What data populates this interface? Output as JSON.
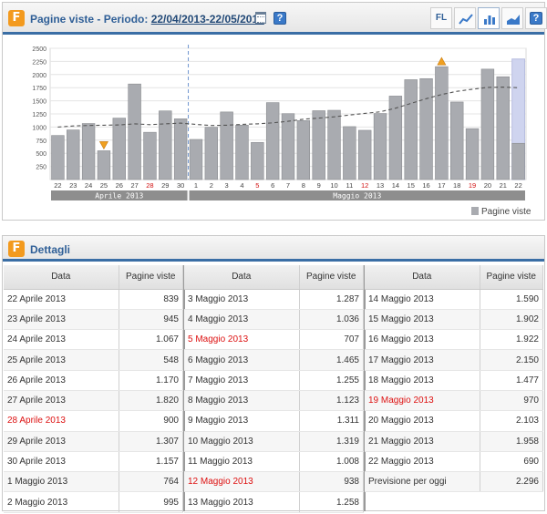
{
  "header": {
    "logo_letter": "F",
    "title_prefix": "Pagine viste - Periodo: ",
    "period": "22/04/2013-22/05/2013",
    "tools": {
      "fl_label": "FL",
      "help_label": "?"
    }
  },
  "legend": {
    "label": "Pagine viste"
  },
  "details": {
    "logo_letter": "F",
    "title": "Dettagli",
    "col_date": "Data",
    "col_value": "Pagine viste",
    "columns": [
      [
        {
          "date": "22 Aprile 2013",
          "value": "839",
          "red": false
        },
        {
          "date": "23 Aprile 2013",
          "value": "945",
          "red": false
        },
        {
          "date": "24 Aprile 2013",
          "value": "1.067",
          "red": false
        },
        {
          "date": "25 Aprile 2013",
          "value": "548",
          "red": false
        },
        {
          "date": "26 Aprile 2013",
          "value": "1.170",
          "red": false
        },
        {
          "date": "27 Aprile 2013",
          "value": "1.820",
          "red": false
        },
        {
          "date": "28 Aprile 2013",
          "value": "900",
          "red": true
        },
        {
          "date": "29 Aprile 2013",
          "value": "1.307",
          "red": false
        },
        {
          "date": "30 Aprile 2013",
          "value": "1.157",
          "red": false
        },
        {
          "date": "1 Maggio 2013",
          "value": "764",
          "red": false
        },
        {
          "date": "2 Maggio 2013",
          "value": "995",
          "red": false
        }
      ],
      [
        {
          "date": "3 Maggio 2013",
          "value": "1.287",
          "red": false
        },
        {
          "date": "4 Maggio 2013",
          "value": "1.036",
          "red": false
        },
        {
          "date": "5 Maggio 2013",
          "value": "707",
          "red": true
        },
        {
          "date": "6 Maggio 2013",
          "value": "1.465",
          "red": false
        },
        {
          "date": "7 Maggio 2013",
          "value": "1.255",
          "red": false
        },
        {
          "date": "8 Maggio 2013",
          "value": "1.123",
          "red": false
        },
        {
          "date": "9 Maggio 2013",
          "value": "1.311",
          "red": false
        },
        {
          "date": "10 Maggio 2013",
          "value": "1.319",
          "red": false
        },
        {
          "date": "11 Maggio 2013",
          "value": "1.008",
          "red": false
        },
        {
          "date": "12 Maggio 2013",
          "value": "938",
          "red": true
        },
        {
          "date": "13 Maggio 2013",
          "value": "1.258",
          "red": false
        }
      ],
      [
        {
          "date": "14 Maggio 2013",
          "value": "1.590",
          "red": false
        },
        {
          "date": "15 Maggio 2013",
          "value": "1.902",
          "red": false
        },
        {
          "date": "16 Maggio 2013",
          "value": "1.922",
          "red": false
        },
        {
          "date": "17 Maggio 2013",
          "value": "2.150",
          "red": false
        },
        {
          "date": "18 Maggio 2013",
          "value": "1.477",
          "red": false
        },
        {
          "date": "19 Maggio 2013",
          "value": "970",
          "red": true
        },
        {
          "date": "20 Maggio 2013",
          "value": "2.103",
          "red": false
        },
        {
          "date": "21 Maggio 2013",
          "value": "1.958",
          "red": false
        },
        {
          "date": "22 Maggio 2013",
          "value": "690",
          "red": false
        },
        {
          "date": "Previsione per oggi",
          "value": "2.296",
          "red": false
        }
      ]
    ]
  },
  "chart_data": {
    "type": "bar",
    "categories": [
      "22",
      "23",
      "24",
      "25",
      "26",
      "27",
      "28",
      "29",
      "30",
      "1",
      "2",
      "3",
      "4",
      "5",
      "6",
      "7",
      "8",
      "9",
      "10",
      "11",
      "12",
      "13",
      "14",
      "15",
      "16",
      "17",
      "18",
      "19",
      "20",
      "21",
      "22"
    ],
    "red_categories": [
      6,
      13,
      20,
      27
    ],
    "series": [
      {
        "name": "Pagine viste",
        "values": [
          839,
          945,
          1067,
          548,
          1170,
          1820,
          900,
          1307,
          1157,
          764,
          995,
          1287,
          1036,
          707,
          1465,
          1255,
          1123,
          1311,
          1319,
          1008,
          938,
          1258,
          1590,
          1902,
          1922,
          2150,
          1477,
          970,
          2103,
          1958,
          690
        ]
      }
    ],
    "forecast": {
      "index": 30,
      "value": 2296
    },
    "trend": [
      1000,
      1020,
      1030,
      1035,
      1040,
      1060,
      1045,
      1060,
      1075,
      1050,
      1030,
      1035,
      1050,
      1060,
      1080,
      1110,
      1150,
      1170,
      1195,
      1230,
      1260,
      1290,
      1360,
      1450,
      1540,
      1620,
      1680,
      1720,
      1755,
      1760,
      1750
    ],
    "markers": {
      "down": [
        3
      ],
      "up": [
        25
      ]
    },
    "groups": [
      {
        "label": "Aprile 2013",
        "from": 0,
        "to": 8
      },
      {
        "label": "Maggio 2013",
        "from": 9,
        "to": 30
      }
    ],
    "yticks": [
      250,
      500,
      750,
      1000,
      1250,
      1500,
      1750,
      2000,
      2250,
      2500
    ],
    "ylim": [
      0,
      2500
    ],
    "grid": true,
    "colors": {
      "bar": "#a9abb0",
      "bar_stroke": "#8a8c90",
      "forecast": "#cfd4ef",
      "trend": "#555555",
      "marker": "#f0a020",
      "red": "#d11111",
      "group": "#8e8e8e"
    }
  }
}
